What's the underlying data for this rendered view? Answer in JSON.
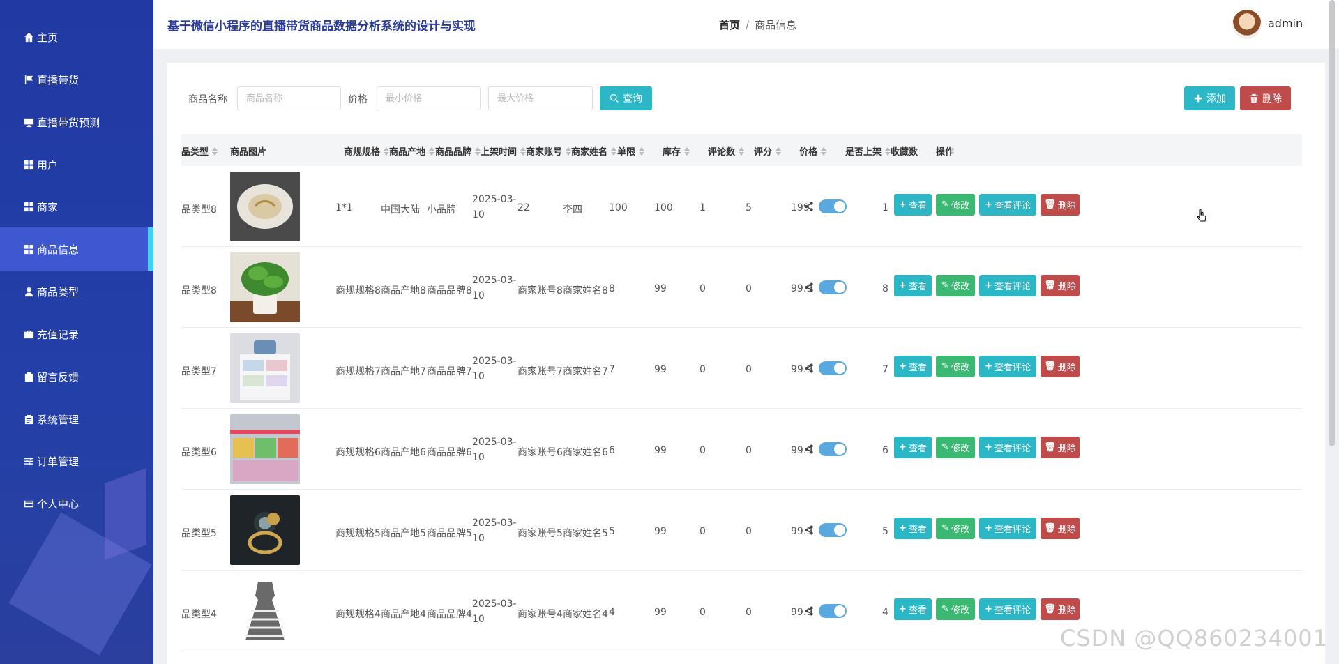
{
  "app": {
    "title": "基于微信小程序的直播带货商品数据分析系统的设计与实现",
    "user": "admin"
  },
  "breadcrumb": {
    "home": "首页",
    "separator": "/",
    "current": "商品信息"
  },
  "sidebar": {
    "items": [
      {
        "label": "主页",
        "icon": "home-icon"
      },
      {
        "label": "直播带货",
        "icon": "flag-icon"
      },
      {
        "label": "直播带货预测",
        "icon": "monitor-icon"
      },
      {
        "label": "用户",
        "icon": "grid-icon"
      },
      {
        "label": "商家",
        "icon": "grid-icon"
      },
      {
        "label": "商品信息",
        "icon": "grid-icon",
        "active": true
      },
      {
        "label": "商品类型",
        "icon": "person-icon"
      },
      {
        "label": "充值记录",
        "icon": "briefcase-icon"
      },
      {
        "label": "留言反馈",
        "icon": "clipboard-check-icon"
      },
      {
        "label": "系统管理",
        "icon": "clipboard-icon"
      },
      {
        "label": "订单管理",
        "icon": "sliders-icon"
      },
      {
        "label": "个人中心",
        "icon": "card-icon"
      }
    ]
  },
  "search": {
    "name_label": "商品名称",
    "name_placeholder": "商品名称",
    "price_label": "价格",
    "min_placeholder": "最小价格",
    "max_placeholder": "最大价格",
    "query_button": "查询",
    "add_button": "添加",
    "delete_button": "删除"
  },
  "table": {
    "headers": {
      "type": "品类型",
      "image": "商品图片",
      "spec": "商规规格",
      "origin": "商品产地",
      "brand": "商品品牌",
      "time": "上架时间",
      "account": "商家账号",
      "merchant": "商家姓名",
      "limit": "单限",
      "stock": "库存",
      "comments": "评论数",
      "rating": "评分",
      "price": "价格",
      "listed": "是否上架",
      "favorites": "收藏数",
      "actions": "操作"
    },
    "action_labels": {
      "view": "查看",
      "edit": "修改",
      "review": "查看评论",
      "delete": "删除"
    },
    "rows": [
      {
        "type": "品类型8",
        "spec": "1*1",
        "origin": "中国大陆",
        "brand": "小品牌",
        "time": "2025-03-10",
        "account": "22",
        "merchant": "李四",
        "limit": "100",
        "stock": "100",
        "comments": "1",
        "rating": "5",
        "price": "199",
        "listed": true,
        "favorites": "1",
        "image": "plate"
      },
      {
        "type": "品类型8",
        "spec": "商规规格8",
        "origin": "商品产地8",
        "brand": "商品品牌8",
        "time": "2025-03-10",
        "account": "商家账号8",
        "merchant": "商家姓名8",
        "limit": "8",
        "stock": "99",
        "comments": "0",
        "rating": "0",
        "price": "99.9",
        "listed": true,
        "favorites": "8",
        "image": "plant"
      },
      {
        "type": "品类型7",
        "spec": "商规规格7",
        "origin": "商品产地7",
        "brand": "商品品牌7",
        "time": "2025-03-10",
        "account": "商家账号7",
        "merchant": "商家姓名7",
        "limit": "7",
        "stock": "99",
        "comments": "0",
        "rating": "0",
        "price": "99.9",
        "listed": true,
        "favorites": "7",
        "image": "drawers"
      },
      {
        "type": "品类型6",
        "spec": "商规规格6",
        "origin": "商品产地6",
        "brand": "商品品牌6",
        "time": "2025-03-10",
        "account": "商家账号6",
        "merchant": "商家姓名6",
        "limit": "6",
        "stock": "99",
        "comments": "0",
        "rating": "0",
        "price": "99.9",
        "listed": true,
        "favorites": "6",
        "image": "shelves"
      },
      {
        "type": "品类型5",
        "spec": "商规规格5",
        "origin": "商品产地5",
        "brand": "商品品牌5",
        "time": "2025-03-10",
        "account": "商家账号5",
        "merchant": "商家姓名5",
        "limit": "5",
        "stock": "99",
        "comments": "0",
        "rating": "0",
        "price": "99.9",
        "listed": true,
        "favorites": "5",
        "image": "ring"
      },
      {
        "type": "品类型4",
        "spec": "商规规格4",
        "origin": "商品产地4",
        "brand": "商品品牌4",
        "time": "2025-03-10",
        "account": "商家账号4",
        "merchant": "商家姓名4",
        "limit": "4",
        "stock": "99",
        "comments": "0",
        "rating": "0",
        "price": "99.9",
        "listed": true,
        "favorites": "4",
        "image": "dress"
      }
    ]
  },
  "watermark": "CSDN @QQ860234001",
  "colors": {
    "sidebar": "#2139a3",
    "active": "#3d58d0",
    "accent": "#2bb7c6",
    "success": "#3bb872",
    "danger": "#c04b4b",
    "toggle": "#5aa8de"
  }
}
